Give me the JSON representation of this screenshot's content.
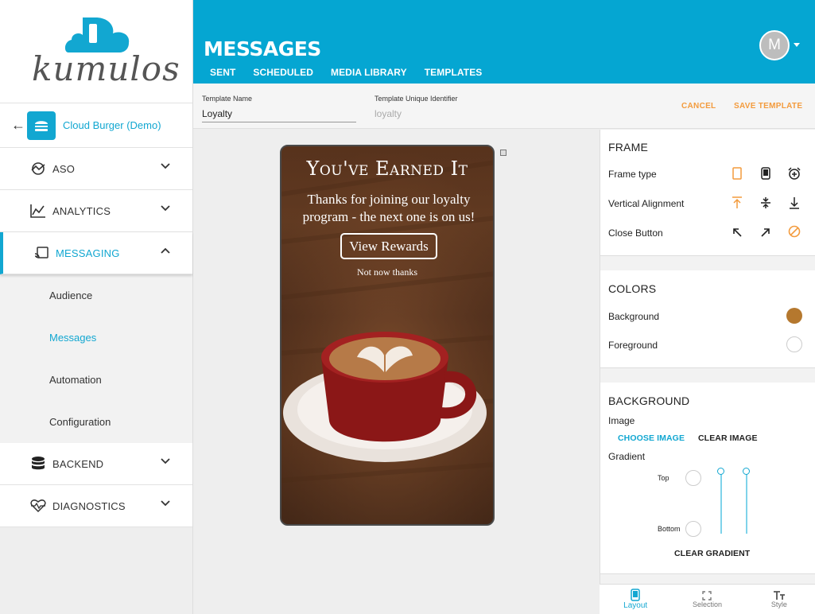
{
  "brand": {
    "logo_text": "kumulos",
    "accent": "#12a7d1",
    "orange": "#f39b3d"
  },
  "sidebar": {
    "back_icon": "arrow-left-icon",
    "app_name": "Cloud Burger (Demo)",
    "items": [
      {
        "label": "ASO",
        "icon": "aso-icon",
        "expanded": false
      },
      {
        "label": "ANALYTICS",
        "icon": "chart-icon",
        "expanded": false
      },
      {
        "label": "MESSAGING",
        "icon": "cast-icon",
        "expanded": true
      },
      {
        "label": "BACKEND",
        "icon": "database-icon",
        "expanded": false
      },
      {
        "label": "DIAGNOSTICS",
        "icon": "heartbeat-icon",
        "expanded": false
      }
    ],
    "messaging_sub": [
      "Audience",
      "Messages",
      "Automation",
      "Configuration"
    ],
    "active_sub": "Messages"
  },
  "header": {
    "title": "MESSAGES",
    "tabs": [
      "SENT",
      "SCHEDULED",
      "MEDIA LIBRARY",
      "TEMPLATES"
    ],
    "active_tab": "TEMPLATES",
    "avatar_initial": "M"
  },
  "template": {
    "name_label": "Template Name",
    "name_value": "Loyalty",
    "id_label": "Template Unique Identifier",
    "id_value": "loyalty",
    "cancel_label": "CANCEL",
    "save_label": "SAVE TEMPLATE"
  },
  "preview": {
    "title": "You've Earned It",
    "body": "Thanks for joining our loyalty program - the next one is on us!",
    "button": "View Rewards",
    "dismiss": "Not now thanks"
  },
  "frame": {
    "title": "FRAME",
    "frame_type_label": "Frame type",
    "vertical_alignment_label": "Vertical Alignment",
    "close_button_label": "Close Button"
  },
  "colors": {
    "title": "COLORS",
    "background_label": "Background",
    "background_color": "#b5782e",
    "foreground_label": "Foreground",
    "foreground_color": "#ffffff"
  },
  "background": {
    "title": "BACKGROUND",
    "image_label": "Image",
    "choose_image": "CHOOSE IMAGE",
    "clear_image": "CLEAR IMAGE",
    "gradient_label": "Gradient",
    "top_label": "Top",
    "bottom_label": "Bottom",
    "clear_gradient": "CLEAR GRADIENT"
  },
  "bottom_nav": {
    "layout": "Layout",
    "selection": "Selection",
    "style": "Style"
  }
}
